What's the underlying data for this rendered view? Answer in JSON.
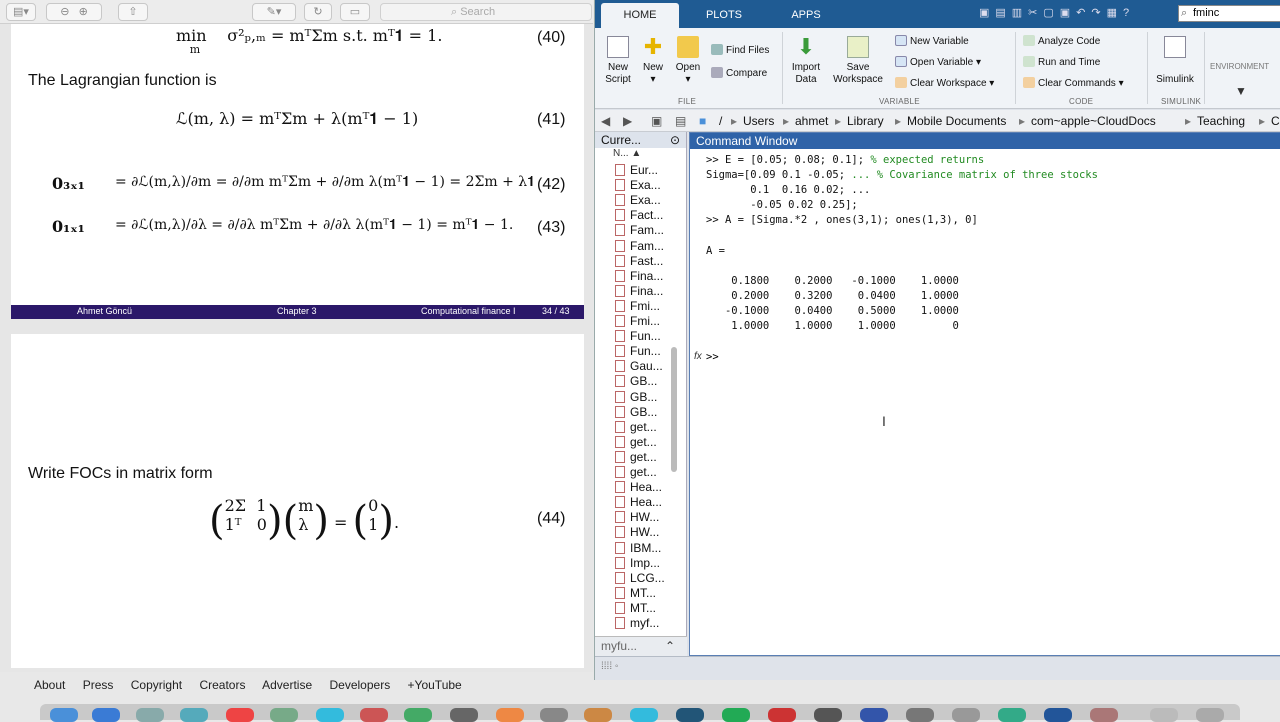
{
  "pdf": {
    "search_placeholder": "Search",
    "page1": {
      "eq40": {
        "lhs_min": "min",
        "lhs_sub": "m",
        "body": "σ²ₚ,ₘ = mᵀΣm s.t. mᵀ𝟏 = 1.",
        "num": "(40)"
      },
      "lagrangian_text": "The Lagrangian function is",
      "eq41": {
        "body": "ℒ(m, λ) = mᵀΣm + λ(mᵀ𝟏 − 1)",
        "num": "(41)"
      },
      "eq42": {
        "lhs": "𝟎₃ₓ₁",
        "body": "= ∂ℒ(m,λ)/∂m = ∂/∂m mᵀΣm + ∂/∂m λ(mᵀ𝟏 − 1) = 2Σm + λ𝟏",
        "num": "(42)"
      },
      "eq43": {
        "lhs": "𝟎₁ₓ₁",
        "body": "= ∂ℒ(m,λ)/∂λ = ∂/∂λ mᵀΣm + ∂/∂λ λ(mᵀ𝟏 − 1) = mᵀ𝟏 − 1.",
        "num": "(43)"
      },
      "footer": {
        "author": "Ahmet Göncü",
        "chapter": "Chapter 3",
        "course": "Computational finance I",
        "page": "34 / 43"
      }
    },
    "page2": {
      "foc_text": "Write FOCs in matrix form",
      "eq44": {
        "m11": "2Σ",
        "m12": "1",
        "m21": "1ᵀ",
        "m22": "0",
        "v1": "m",
        "v2": "λ",
        "r1": "0",
        "r2": "1",
        "num": "(44)"
      }
    }
  },
  "youtube_links": [
    "About",
    "Press",
    "Copyright",
    "Creators",
    "Advertise",
    "Developers",
    "+YouTube"
  ],
  "matlab": {
    "tabs": [
      "HOME",
      "PLOTS",
      "APPS"
    ],
    "quick_search": "fminc",
    "ribbon": {
      "new_script": "New Script",
      "new": "New",
      "open": "Open",
      "find_files": "Find Files",
      "compare": "Compare",
      "import_data": "Import Data",
      "save_workspace": "Save Workspace",
      "new_variable": "New Variable",
      "open_variable": "Open Variable",
      "clear_workspace": "Clear Workspace",
      "analyze_code": "Analyze Code",
      "run_and_time": "Run and Time",
      "clear_commands": "Clear Commands",
      "simulink": "Simulink",
      "environment": "ENVIRONMENT",
      "sections": [
        "FILE",
        "VARIABLE",
        "CODE",
        "SIMULINK"
      ]
    },
    "path": [
      "/",
      "Users",
      "ahmet",
      "Library",
      "Mobile Documents",
      "com~apple~CloudDocs",
      "Teaching",
      "CF Tu"
    ],
    "current_folder": {
      "title": "Curre...",
      "column": "N...",
      "files": [
        "Eur...",
        "Exa...",
        "Exa...",
        "Fact...",
        "Fam...",
        "Fam...",
        "Fast...",
        "Fina...",
        "Fina...",
        "Fmi...",
        "Fmi...",
        "Fun...",
        "Fun...",
        "Gau...",
        "GB...",
        "GB...",
        "GB...",
        "get...",
        "get...",
        "get...",
        "get...",
        "Hea...",
        "Hea...",
        "HW...",
        "HW...",
        "IBM...",
        "Imp...",
        "LCG...",
        "MT...",
        "MT...",
        "myf..."
      ],
      "footer": "myfu..."
    },
    "command_window": {
      "title": "Command Window",
      "lines": [
        {
          "code": ">> E = [0.05; 0.08; 0.1]; ",
          "comment": "% expected returns"
        },
        {
          "code": "Sigma=[0.09 0.1 -0.05; ",
          "comment": "... % Covariance matrix of three stocks"
        },
        {
          "code": "       0.1  0.16 0.02; ...",
          "comment": ""
        },
        {
          "code": "       -0.05 0.02 0.25];",
          "comment": ""
        },
        {
          "code": ">> A = [Sigma.*2 , ones(3,1); ones(1,3), 0]",
          "comment": ""
        },
        {
          "code": "",
          "comment": ""
        },
        {
          "code": "A =",
          "comment": ""
        },
        {
          "code": "",
          "comment": ""
        },
        {
          "code": "    0.1800    0.2000   -0.1000    1.0000",
          "comment": ""
        },
        {
          "code": "    0.2000    0.3200    0.0400    1.0000",
          "comment": ""
        },
        {
          "code": "   -0.1000    0.0400    0.5000    1.0000",
          "comment": ""
        },
        {
          "code": "    1.0000    1.0000    1.0000         0",
          "comment": ""
        },
        {
          "code": "",
          "comment": ""
        }
      ],
      "prompt_fx": "fx",
      "prompt": ">>"
    }
  }
}
